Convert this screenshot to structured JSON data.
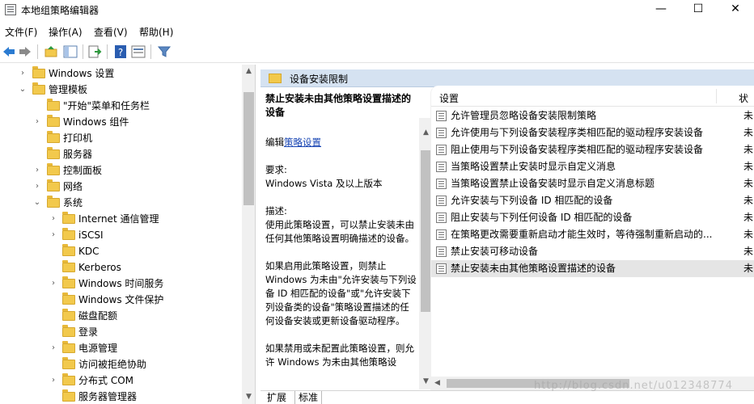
{
  "window": {
    "title": "本地组策略编辑器",
    "minimize": "—",
    "maximize": "☐",
    "close": "✕"
  },
  "menu": [
    "文件(F)",
    "操作(A)",
    "查看(V)",
    "帮助(H)"
  ],
  "tree": [
    {
      "label": "Windows 设置",
      "level": 1,
      "arrow": "›"
    },
    {
      "label": "管理模板",
      "level": 0,
      "arrow": "⌄"
    },
    {
      "label": "\"开始\"菜单和任务栏",
      "level": 1,
      "arrow": ""
    },
    {
      "label": "Windows 组件",
      "level": 1,
      "arrow": "›"
    },
    {
      "label": "打印机",
      "level": 1,
      "arrow": ""
    },
    {
      "label": "服务器",
      "level": 1,
      "arrow": ""
    },
    {
      "label": "控制面板",
      "level": 1,
      "arrow": "›"
    },
    {
      "label": "网络",
      "level": 1,
      "arrow": "›"
    },
    {
      "label": "系统",
      "level": 1,
      "arrow": "⌄"
    },
    {
      "label": "Internet 通信管理",
      "level": 2,
      "arrow": "›"
    },
    {
      "label": "iSCSI",
      "level": 2,
      "arrow": "›"
    },
    {
      "label": "KDC",
      "level": 2,
      "arrow": ""
    },
    {
      "label": "Kerberos",
      "level": 2,
      "arrow": ""
    },
    {
      "label": "Windows 时间服务",
      "level": 2,
      "arrow": "›"
    },
    {
      "label": "Windows 文件保护",
      "level": 2,
      "arrow": ""
    },
    {
      "label": "磁盘配额",
      "level": 2,
      "arrow": ""
    },
    {
      "label": "登录",
      "level": 2,
      "arrow": ""
    },
    {
      "label": "电源管理",
      "level": 2,
      "arrow": "›"
    },
    {
      "label": "访问被拒绝协助",
      "level": 2,
      "arrow": ""
    },
    {
      "label": "分布式 COM",
      "level": 2,
      "arrow": "›"
    },
    {
      "label": "服务器管理器",
      "level": 2,
      "arrow": ""
    }
  ],
  "right": {
    "header": "设备安装限制",
    "description": {
      "title": "禁止安装未由其他策略设置描述的设备",
      "edit_prefix": "编辑",
      "edit_link": "策略设置",
      "requirements_label": "要求:",
      "requirements": "Windows Vista 及以上版本",
      "desc_label": "描述:",
      "p1": "使用此策略设置，可以禁止安装未由任何其他策略设置明确描述的设备。",
      "p2": "如果启用此策略设置，则禁止 Windows 为未由\"允许安装与下列设备 ID 相匹配的设备\"或\"允许安装下列设备类的设备\"策略设置描述的任何设备安装或更新设备驱动程序。",
      "p3": "如果禁用或未配置此策略设置，则允许 Windows 为未由其他策略设"
    },
    "list": {
      "col_setting": "设置",
      "col_state": "状",
      "rows": [
        {
          "label": "允许管理员忽略设备安装限制策略",
          "state": "未"
        },
        {
          "label": "允许使用与下列设备安装程序类相匹配的驱动程序安装设备",
          "state": "未"
        },
        {
          "label": "阻止使用与下列设备安装程序类相匹配的驱动程序安装设备",
          "state": "未"
        },
        {
          "label": "当策略设置禁止安装时显示自定义消息",
          "state": "未"
        },
        {
          "label": "当策略设置禁止设备安装时显示自定义消息标题",
          "state": "未"
        },
        {
          "label": "允许安装与下列设备 ID 相匹配的设备",
          "state": "未"
        },
        {
          "label": "阻止安装与下列任何设备 ID 相匹配的设备",
          "state": "未"
        },
        {
          "label": "在策略更改需要重新启动才能生效时，等待强制重新启动的...",
          "state": "未"
        },
        {
          "label": "禁止安装可移动设备",
          "state": "未"
        },
        {
          "label": "禁止安装未由其他策略设置描述的设备",
          "state": "未"
        }
      ]
    },
    "tabs": [
      "扩展",
      "标准"
    ]
  },
  "watermark": "http://blog.csdn.net/u012348774"
}
